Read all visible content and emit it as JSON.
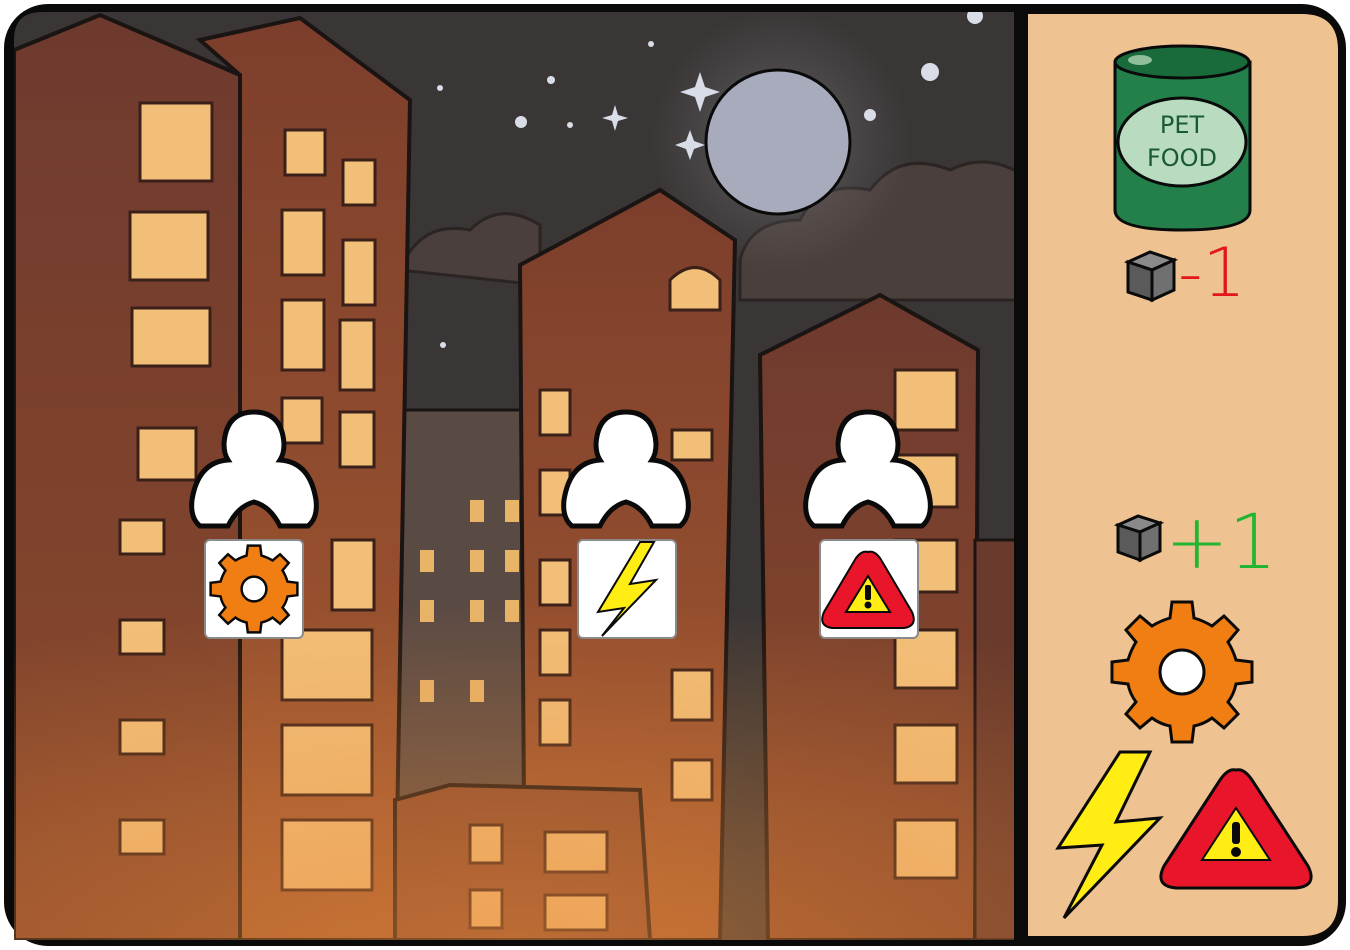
{
  "card": {
    "pet_food_label_line1": "PET",
    "pet_food_label_line2": "FOOD",
    "cost_value": "-1",
    "gain_value": "+1"
  },
  "slots": [
    {
      "icon": "gear-icon"
    },
    {
      "icon": "lightning-icon"
    },
    {
      "icon": "warning-icon"
    }
  ],
  "colors": {
    "sky": "#3a3636",
    "brick": "#7a4030",
    "panel": "#eec291",
    "gear": "#f07e12",
    "lightning": "#ffed14",
    "warning": "#e8152b",
    "can": "#23804a",
    "cost_red": "#e3151d",
    "gain_green": "#22b532"
  }
}
